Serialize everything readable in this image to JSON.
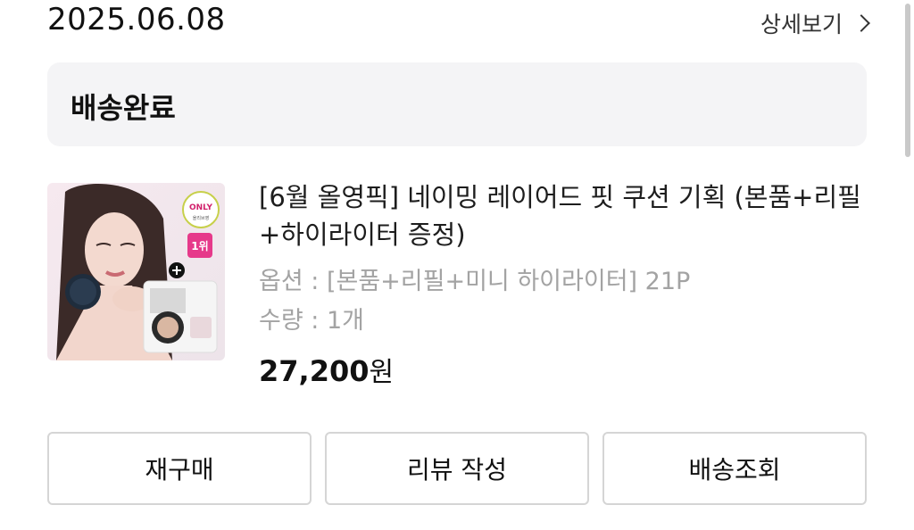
{
  "order": {
    "date": "2025.06.08",
    "detail_label": "상세보기"
  },
  "status": {
    "label": "배송완료"
  },
  "product": {
    "title": "[6월 올영픽] 네이밍 레이어드 핏 쿠션 기획 (본품+리필+하이라이터 증정)",
    "option": "옵션 : [본품+리필+미니 하이라이터] 21P",
    "quantity": "수량 : 1개",
    "price_value": "27,200",
    "price_unit": "원",
    "thumbnail": {
      "badge_top": "ONLY",
      "badge_sub": "올리브영 단독기획",
      "rank_badge": "1위",
      "plus_icon": "plus-icon"
    }
  },
  "actions": {
    "rebuy_label": "재구매",
    "review_label": "리뷰 작성",
    "tracking_label": "배송조회"
  },
  "colors": {
    "status_bg": "#f4f4f6",
    "button_border": "#d5d5d5",
    "muted_text": "#a3a3a3",
    "rank_badge": "#e6398a"
  }
}
